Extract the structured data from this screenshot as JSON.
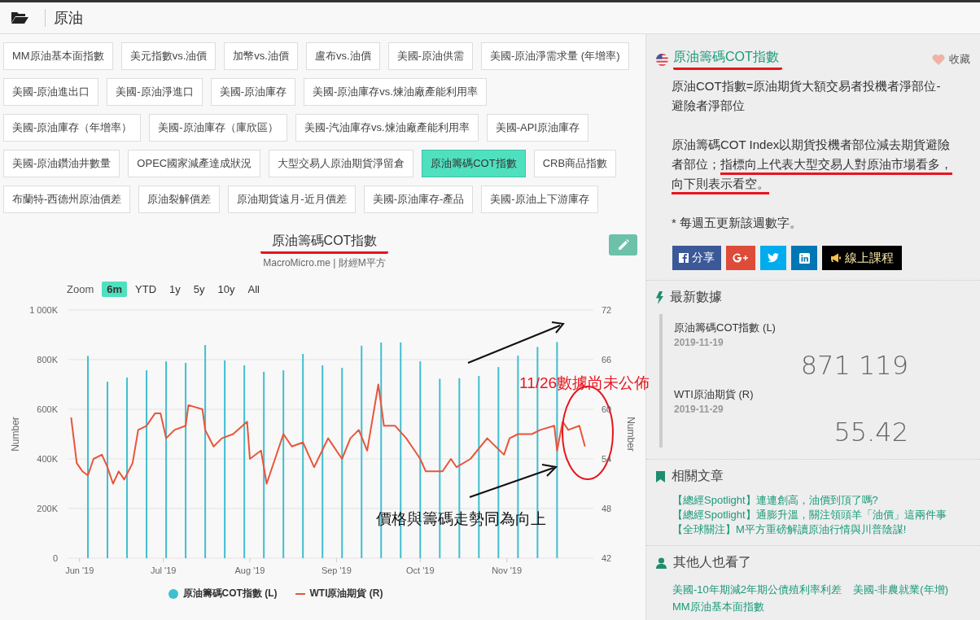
{
  "header": {
    "title": "原油"
  },
  "tag_rows": [
    [
      {
        "label": "MM原油基本面指數",
        "selected": false
      },
      {
        "label": "美元指數vs.油價",
        "selected": false
      },
      {
        "label": "加幣vs.油價",
        "selected": false
      },
      {
        "label": "盧布vs.油價",
        "selected": false
      },
      {
        "label": "美國-原油供需",
        "selected": false
      },
      {
        "label": "美國-原油淨需求量 (年增率)",
        "selected": false
      }
    ],
    [
      {
        "label": "美國-原油進出口",
        "selected": false
      },
      {
        "label": "美國-原油淨進口",
        "selected": false
      },
      {
        "label": "美國-原油庫存",
        "selected": false
      },
      {
        "label": "美國-原油庫存vs.煉油廠產能利用率",
        "selected": false
      }
    ],
    [
      {
        "label": "美國-原油庫存（年增率）",
        "selected": false
      },
      {
        "label": "美國-原油庫存（庫欣區）",
        "selected": false
      },
      {
        "label": "美國-汽油庫存vs.煉油廠產能利用率",
        "selected": false
      },
      {
        "label": "美國-API原油庫存",
        "selected": false
      }
    ],
    [
      {
        "label": "美國-原油鑽油井數量",
        "selected": false
      },
      {
        "label": "OPEC國家減產達成狀況",
        "selected": false
      },
      {
        "label": "大型交易人原油期貨淨留倉",
        "selected": false
      },
      {
        "label": "原油籌碼COT指數",
        "selected": true
      },
      {
        "label": "CRB商品指數",
        "selected": false
      }
    ],
    [
      {
        "label": "布蘭特-西德州原油價差",
        "selected": false
      },
      {
        "label": "原油裂解價差",
        "selected": false
      },
      {
        "label": "原油期貨遠月-近月價差",
        "selected": false
      },
      {
        "label": "美國-原油庫存-產品",
        "selected": false
      },
      {
        "label": "美國-原油上下游庫存",
        "selected": false
      }
    ]
  ],
  "chart": {
    "title": "原油籌碼COT指數",
    "title_marked": true,
    "subtitle": "MacroMicro.me | 財經M平方",
    "zoom_label": "Zoom",
    "zoom_options": [
      {
        "label": "6m",
        "selected": true
      },
      {
        "label": "YTD",
        "selected": false
      },
      {
        "label": "1y",
        "selected": false
      },
      {
        "label": "5y",
        "selected": false
      },
      {
        "label": "10y",
        "selected": false
      },
      {
        "label": "All",
        "selected": false
      }
    ],
    "chart_data": {
      "type": "bar",
      "grid": true,
      "ylabel": "Number",
      "y2label": "Number",
      "xlim": [
        "2019-05-28",
        "2019-12-02"
      ],
      "ylim": [
        0,
        1000
      ],
      "y2lim": [
        42,
        72
      ],
      "xticks": [
        {
          "value": "2019-06-01",
          "label": "Jun '19"
        },
        {
          "value": "2019-07-01",
          "label": "Jul '19"
        },
        {
          "value": "2019-08-01",
          "label": "Aug '19"
        },
        {
          "value": "2019-09-01",
          "label": "Sep '19"
        },
        {
          "value": "2019-10-01",
          "label": "Oct '19"
        },
        {
          "value": "2019-11-01",
          "label": "Nov '19"
        }
      ],
      "yticks": [
        {
          "value": 0,
          "label": "0"
        },
        {
          "value": 200,
          "label": "200K"
        },
        {
          "value": 400,
          "label": "400K"
        },
        {
          "value": 600,
          "label": "600K"
        },
        {
          "value": 800,
          "label": "800K"
        },
        {
          "value": 1000,
          "label": "1 000K"
        }
      ],
      "y2ticks": [
        42,
        48,
        54,
        60,
        66,
        72
      ],
      "series": [
        {
          "name": "原油籌碼COT指數 (L)",
          "type": "bar",
          "color": "#3fbfd0",
          "x": [
            "2019-06-04",
            "2019-06-11",
            "2019-06-18",
            "2019-06-25",
            "2019-07-02",
            "2019-07-09",
            "2019-07-16",
            "2019-07-23",
            "2019-07-30",
            "2019-08-06",
            "2019-08-13",
            "2019-08-20",
            "2019-08-27",
            "2019-09-03",
            "2019-09-10",
            "2019-09-17",
            "2019-09-24",
            "2019-10-01",
            "2019-10-08",
            "2019-10-15",
            "2019-10-22",
            "2019-10-29",
            "2019-11-05",
            "2019-11-12",
            "2019-11-19"
          ],
          "values": [
            815,
            711,
            728,
            757,
            793,
            787,
            859,
            797,
            777,
            751,
            757,
            823,
            777,
            767,
            856,
            869,
            869,
            793,
            723,
            725,
            734,
            770,
            816,
            851,
            871
          ]
        },
        {
          "name": "WTI原油期貨 (R)",
          "type": "line",
          "axis": "y2",
          "color": "#e8553a",
          "x": [
            "2019-05-29",
            "2019-05-31",
            "2019-06-02",
            "2019-06-04",
            "2019-06-06",
            "2019-06-09",
            "2019-06-11",
            "2019-06-13",
            "2019-06-15",
            "2019-06-17",
            "2019-06-20",
            "2019-06-22",
            "2019-06-25",
            "2019-06-28",
            "2019-06-30",
            "2019-07-02",
            "2019-07-05",
            "2019-07-09",
            "2019-07-10",
            "2019-07-15",
            "2019-07-16",
            "2019-07-19",
            "2019-07-22",
            "2019-07-26",
            "2019-07-31",
            "2019-08-01",
            "2019-08-05",
            "2019-08-07",
            "2019-08-10",
            "2019-08-13",
            "2019-08-16",
            "2019-08-20",
            "2019-08-24",
            "2019-08-29",
            "2019-09-03",
            "2019-09-06",
            "2019-09-09",
            "2019-09-12",
            "2019-09-16",
            "2019-09-18",
            "2019-09-22",
            "2019-09-26",
            "2019-09-29",
            "2019-10-01",
            "2019-10-03",
            "2019-10-09",
            "2019-10-12",
            "2019-10-14",
            "2019-10-19",
            "2019-10-25",
            "2019-10-31",
            "2019-11-02",
            "2019-11-05",
            "2019-11-10",
            "2019-11-13",
            "2019-11-18",
            "2019-11-19",
            "2019-11-21",
            "2019-11-23",
            "2019-11-27",
            "2019-11-29"
          ],
          "values": [
            59,
            53.5,
            52.5,
            52,
            54,
            54.5,
            53,
            51,
            52.5,
            51.5,
            53.5,
            57.5,
            58,
            59.5,
            59.5,
            56.5,
            57.5,
            58,
            60.5,
            60,
            57.5,
            55.5,
            56.5,
            57,
            58.5,
            54,
            55,
            51,
            54,
            57,
            55.5,
            56,
            53,
            56.5,
            54,
            56.5,
            57.5,
            55,
            63,
            58,
            58,
            56.5,
            55,
            54,
            52.5,
            52.5,
            54,
            53,
            54,
            56.5,
            54.5,
            56.5,
            57,
            57,
            57.5,
            58,
            55,
            58.5,
            57.5,
            58,
            55.5
          ]
        }
      ],
      "annotations": [
        {
          "text": "價格與籌碼走勢同為向上"
        }
      ]
    }
  },
  "overlay_note": {
    "text": "11/26數據尚未公佈",
    "color": "#e8141e"
  },
  "sidebar": {
    "title": "原油籌碼COT指數",
    "title_marked": true,
    "favorite_label": "收藏",
    "paragraphs": [
      {
        "text": "原油COT指數=原油期貨大額交易者投機者淨部位-避險者淨部位"
      },
      {
        "text": "原油籌碼COT Index以期貨投機者部位減去期貨避險者部位；",
        "marked": "指標向上代表大型交易人對原油市場看多，向下則表示看空。"
      },
      {
        "text": "* 每週五更新該週數字。"
      }
    ],
    "share_buttons": [
      {
        "kind": "facebook",
        "label": "分享"
      },
      {
        "kind": "google"
      },
      {
        "kind": "twitter"
      },
      {
        "kind": "linkedin"
      },
      {
        "kind": "course",
        "label": "線上課程"
      }
    ],
    "latest": {
      "title": "最新數據",
      "items": [
        {
          "name": "原油籌碼COT指數 (L)",
          "date": "2019-11-19",
          "value": "871 119"
        },
        {
          "name": "WTI原油期貨 (R)",
          "date": "2019-11-29",
          "value": "55.42"
        }
      ]
    },
    "articles": {
      "title": "相關文章",
      "links": [
        "【總經Spotlight】連連創高，油價到頂了嗎?",
        "【總經Spotlight】通膨升溫，關注領頭羊「油價」這兩件事",
        "【全球關注】M平方重磅解讀原油行情與川普陰謀!"
      ]
    },
    "others": {
      "title": "其他人也看了",
      "links": [
        "美國-10年期減2年期公債殖利率利差",
        "美國-非農就業(年增)",
        "MM原油基本面指數"
      ]
    }
  }
}
